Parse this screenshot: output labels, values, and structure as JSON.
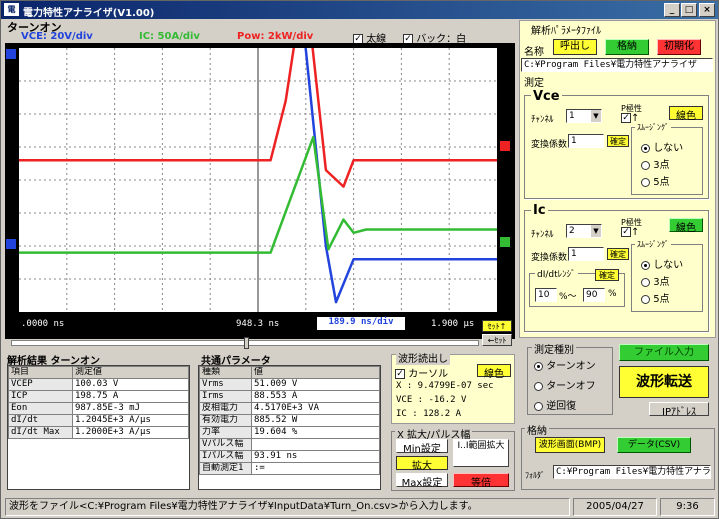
{
  "window": {
    "title": "電力特性アナライザ(V1.00)",
    "app_icon": "電",
    "min": "_",
    "max": "□",
    "close": "×"
  },
  "scope": {
    "title": "ターンオン",
    "vce_scale": "VCE: 20V/div",
    "ic_scale": "IC: 50A/div",
    "pow_scale": "Pow: 2kW/div",
    "bold_label": "太線",
    "back_label": "バック：白",
    "left_time": ".0000 ns",
    "mid_time": "948.3 ns",
    "div_time": "189.9 ns/div",
    "right_time": "1.900 μs",
    "set_button": "ｾｯﾄ↑",
    "reset_button": "←ｾｯﾄ",
    "colors": {
      "vce": "#2244dd",
      "ic": "#33bb33",
      "pow": "#ee2222"
    }
  },
  "results": {
    "title": "解析結果  ターンオン",
    "headers": [
      "項目",
      "測定値"
    ],
    "rows": [
      [
        "VCEP",
        "100.03 V"
      ],
      [
        "ICP",
        "198.75 A"
      ],
      [
        "Eon",
        "987.85E-3 mJ"
      ],
      [
        "dI/dt",
        "1.2045E+3 A/μs"
      ],
      [
        "dI/dt Max",
        "1.2000E+3 A/μs"
      ]
    ]
  },
  "common": {
    "title": "共通パラメータ",
    "headers": [
      "種類",
      "値"
    ],
    "rows": [
      [
        "Vrms",
        "51.009 V"
      ],
      [
        "Irms",
        "88.553 A"
      ],
      [
        "皮相電力",
        "4.5170E+3 VA"
      ],
      [
        "有効電力",
        "885.52 W"
      ],
      [
        "力率",
        "19.604 %"
      ],
      [
        "Vパルス幅",
        ""
      ],
      [
        "Iパルス幅",
        "93.91 ns"
      ],
      [
        "自動測定1",
        ":="
      ]
    ]
  },
  "waveform_read": {
    "title": "波形読出し",
    "cursor_label": "カーソル",
    "line_color_button": "線色",
    "x": "X   :  9.4799E-07 sec",
    "vce": "VCE : -16.2 V",
    "ic": "IC  :  128.2 A"
  },
  "zoom": {
    "title": "X 拡大/パルス幅",
    "min_set": "Min設定",
    "range_zoom": "I..I範囲拡大",
    "zoom": "拡大",
    "max_set": "Max設定",
    "equal": "等倍"
  },
  "param_file": {
    "title": "解析ﾊﾟﾗﾒｰﾀﾌｧｲﾙ",
    "name_label": "名称",
    "load": "呼出し",
    "store": "格納",
    "init": "初期化",
    "path": "C:¥Program Files¥電力特性アナライザ"
  },
  "measure": {
    "title": "測定",
    "vce": {
      "title": "Vce",
      "channel_label": "ﾁｬﾝﾈﾙ",
      "channel": "1",
      "polarity_label": "P極性",
      "polarity": "↑",
      "color_button": "線色",
      "coef_label": "変換係数",
      "coef": "1",
      "confirm": "確定",
      "smoothing_title": "ｽﾑｰｼﾞﾝｸﾞ",
      "options": [
        "しない",
        "3点",
        "5点"
      ]
    },
    "ic": {
      "title": "Ic",
      "channel_label": "ﾁｬﾝﾈﾙ",
      "channel": "2",
      "polarity_label": "P極性",
      "polarity": "↑",
      "color_button": "線色",
      "coef_label": "変換係数",
      "coef": "1",
      "confirm": "確定",
      "smoothing_title": "ｽﾑｰｼﾞﾝｸﾞ",
      "options": [
        "しない",
        "3点",
        "5点"
      ],
      "didt_title": "dI/dtﾚﾝｼﾞ",
      "didt_confirm": "確定",
      "didt_from": "10",
      "didt_mid": "%～",
      "didt_to": "90",
      "didt_unit": "%"
    }
  },
  "measure_type": {
    "title": "測定種別",
    "options": [
      "ターンオン",
      "ターンオフ",
      "逆回復"
    ],
    "file_input": "ファイル入力",
    "transfer": "波形転送",
    "ip_address": "IPｱﾄﾞﾚｽ"
  },
  "store_section": {
    "title": "格納",
    "waveform_bmp": "波形画面(BMP)",
    "data_csv": "データ(CSV)",
    "folder_label": "ﾌｫﾙﾀﾞ",
    "folder_path": "C:¥Program Files¥電力特性アナライザ"
  },
  "status": {
    "message": "波形をファイル<C:¥Program Files¥電力特性アナライザ¥InputData¥Turn_On.csv>から入力します。",
    "date": "2005/04/27",
    "time": "9:36"
  },
  "chart_data": {
    "type": "line",
    "x_unit": "ns",
    "xlim": [
      0,
      1900
    ],
    "series": [
      {
        "name": "VCE",
        "color": "#2244dd",
        "x": [
          0,
          700,
          1130,
          1220,
          1260,
          1330,
          1900
        ],
        "y": [
          8.7,
          8.7,
          8.7,
          2,
          0.3,
          1.6,
          1.6
        ]
      },
      {
        "name": "IC",
        "color": "#33bb33",
        "x": [
          0,
          1000,
          1170,
          1230,
          1290,
          1330,
          1380,
          1900
        ],
        "y": [
          1.8,
          1.8,
          5.3,
          1.9,
          2.8,
          2.4,
          2.5,
          2.5
        ]
      },
      {
        "name": "Pow",
        "color": "#ee2222",
        "x": [
          0,
          1000,
          1060,
          1110,
          1160,
          1220,
          1290,
          1330,
          1900
        ],
        "y": [
          4.6,
          4.6,
          6.4,
          8.9,
          8.5,
          4.3,
          3.8,
          4.6,
          4.6
        ]
      }
    ]
  }
}
